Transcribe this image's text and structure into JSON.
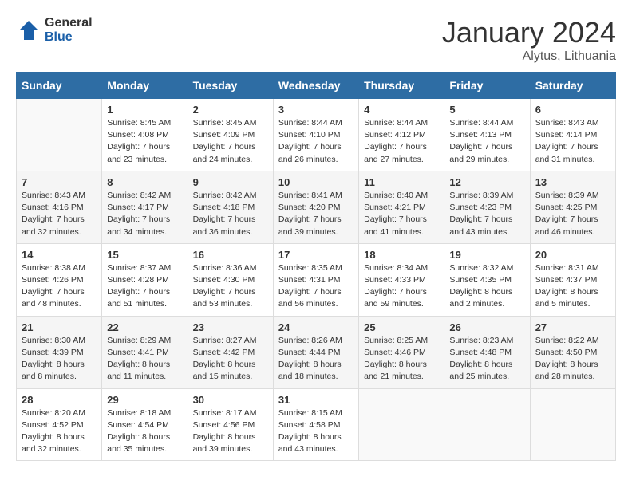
{
  "header": {
    "logo_general": "General",
    "logo_blue": "Blue",
    "month": "January 2024",
    "location": "Alytus, Lithuania"
  },
  "days_of_week": [
    "Sunday",
    "Monday",
    "Tuesday",
    "Wednesday",
    "Thursday",
    "Friday",
    "Saturday"
  ],
  "weeks": [
    [
      {
        "day": "",
        "info": ""
      },
      {
        "day": "1",
        "info": "Sunrise: 8:45 AM\nSunset: 4:08 PM\nDaylight: 7 hours\nand 23 minutes."
      },
      {
        "day": "2",
        "info": "Sunrise: 8:45 AM\nSunset: 4:09 PM\nDaylight: 7 hours\nand 24 minutes."
      },
      {
        "day": "3",
        "info": "Sunrise: 8:44 AM\nSunset: 4:10 PM\nDaylight: 7 hours\nand 26 minutes."
      },
      {
        "day": "4",
        "info": "Sunrise: 8:44 AM\nSunset: 4:12 PM\nDaylight: 7 hours\nand 27 minutes."
      },
      {
        "day": "5",
        "info": "Sunrise: 8:44 AM\nSunset: 4:13 PM\nDaylight: 7 hours\nand 29 minutes."
      },
      {
        "day": "6",
        "info": "Sunrise: 8:43 AM\nSunset: 4:14 PM\nDaylight: 7 hours\nand 31 minutes."
      }
    ],
    [
      {
        "day": "7",
        "info": "Sunrise: 8:43 AM\nSunset: 4:16 PM\nDaylight: 7 hours\nand 32 minutes."
      },
      {
        "day": "8",
        "info": "Sunrise: 8:42 AM\nSunset: 4:17 PM\nDaylight: 7 hours\nand 34 minutes."
      },
      {
        "day": "9",
        "info": "Sunrise: 8:42 AM\nSunset: 4:18 PM\nDaylight: 7 hours\nand 36 minutes."
      },
      {
        "day": "10",
        "info": "Sunrise: 8:41 AM\nSunset: 4:20 PM\nDaylight: 7 hours\nand 39 minutes."
      },
      {
        "day": "11",
        "info": "Sunrise: 8:40 AM\nSunset: 4:21 PM\nDaylight: 7 hours\nand 41 minutes."
      },
      {
        "day": "12",
        "info": "Sunrise: 8:39 AM\nSunset: 4:23 PM\nDaylight: 7 hours\nand 43 minutes."
      },
      {
        "day": "13",
        "info": "Sunrise: 8:39 AM\nSunset: 4:25 PM\nDaylight: 7 hours\nand 46 minutes."
      }
    ],
    [
      {
        "day": "14",
        "info": "Sunrise: 8:38 AM\nSunset: 4:26 PM\nDaylight: 7 hours\nand 48 minutes."
      },
      {
        "day": "15",
        "info": "Sunrise: 8:37 AM\nSunset: 4:28 PM\nDaylight: 7 hours\nand 51 minutes."
      },
      {
        "day": "16",
        "info": "Sunrise: 8:36 AM\nSunset: 4:30 PM\nDaylight: 7 hours\nand 53 minutes."
      },
      {
        "day": "17",
        "info": "Sunrise: 8:35 AM\nSunset: 4:31 PM\nDaylight: 7 hours\nand 56 minutes."
      },
      {
        "day": "18",
        "info": "Sunrise: 8:34 AM\nSunset: 4:33 PM\nDaylight: 7 hours\nand 59 minutes."
      },
      {
        "day": "19",
        "info": "Sunrise: 8:32 AM\nSunset: 4:35 PM\nDaylight: 8 hours\nand 2 minutes."
      },
      {
        "day": "20",
        "info": "Sunrise: 8:31 AM\nSunset: 4:37 PM\nDaylight: 8 hours\nand 5 minutes."
      }
    ],
    [
      {
        "day": "21",
        "info": "Sunrise: 8:30 AM\nSunset: 4:39 PM\nDaylight: 8 hours\nand 8 minutes."
      },
      {
        "day": "22",
        "info": "Sunrise: 8:29 AM\nSunset: 4:41 PM\nDaylight: 8 hours\nand 11 minutes."
      },
      {
        "day": "23",
        "info": "Sunrise: 8:27 AM\nSunset: 4:42 PM\nDaylight: 8 hours\nand 15 minutes."
      },
      {
        "day": "24",
        "info": "Sunrise: 8:26 AM\nSunset: 4:44 PM\nDaylight: 8 hours\nand 18 minutes."
      },
      {
        "day": "25",
        "info": "Sunrise: 8:25 AM\nSunset: 4:46 PM\nDaylight: 8 hours\nand 21 minutes."
      },
      {
        "day": "26",
        "info": "Sunrise: 8:23 AM\nSunset: 4:48 PM\nDaylight: 8 hours\nand 25 minutes."
      },
      {
        "day": "27",
        "info": "Sunrise: 8:22 AM\nSunset: 4:50 PM\nDaylight: 8 hours\nand 28 minutes."
      }
    ],
    [
      {
        "day": "28",
        "info": "Sunrise: 8:20 AM\nSunset: 4:52 PM\nDaylight: 8 hours\nand 32 minutes."
      },
      {
        "day": "29",
        "info": "Sunrise: 8:18 AM\nSunset: 4:54 PM\nDaylight: 8 hours\nand 35 minutes."
      },
      {
        "day": "30",
        "info": "Sunrise: 8:17 AM\nSunset: 4:56 PM\nDaylight: 8 hours\nand 39 minutes."
      },
      {
        "day": "31",
        "info": "Sunrise: 8:15 AM\nSunset: 4:58 PM\nDaylight: 8 hours\nand 43 minutes."
      },
      {
        "day": "",
        "info": ""
      },
      {
        "day": "",
        "info": ""
      },
      {
        "day": "",
        "info": ""
      }
    ]
  ]
}
